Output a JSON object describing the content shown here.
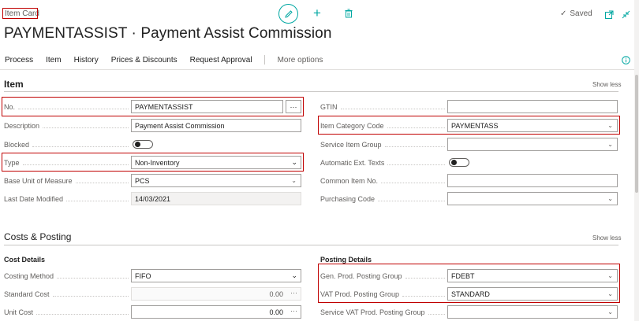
{
  "header": {
    "caption": "Item Card",
    "title": "PAYMENTASSIST · Payment Assist Commission",
    "saved_label": "Saved"
  },
  "action_bar": {
    "items": [
      "Process",
      "Item",
      "History",
      "Prices & Discounts",
      "Request Approval"
    ],
    "more_options": "More options"
  },
  "sections": {
    "item": {
      "title": "Item",
      "show_less": "Show less"
    },
    "costs": {
      "title": "Costs & Posting",
      "show_less": "Show less",
      "cost_details": "Cost Details",
      "posting_details": "Posting Details"
    }
  },
  "item_left": [
    {
      "label": "No.",
      "value": "PAYMENTASSIST"
    },
    {
      "label": "Description",
      "value": "Payment Assist Commission"
    },
    {
      "label": "Blocked",
      "value": "off"
    },
    {
      "label": "Type",
      "value": "Non-Inventory"
    },
    {
      "label": "Base Unit of Measure",
      "value": "PCS"
    },
    {
      "label": "Last Date Modified",
      "value": "14/03/2021"
    }
  ],
  "item_right": [
    {
      "label": "GTIN",
      "value": ""
    },
    {
      "label": "Item Category Code",
      "value": "PAYMENTASS"
    },
    {
      "label": "Service Item Group",
      "value": ""
    },
    {
      "label": "Automatic Ext. Texts",
      "value": "off"
    },
    {
      "label": "Common Item No.",
      "value": ""
    },
    {
      "label": "Purchasing Code",
      "value": ""
    }
  ],
  "cost_left": [
    {
      "label": "Costing Method",
      "value": "FIFO"
    },
    {
      "label": "Standard Cost",
      "value": "0.00"
    },
    {
      "label": "Unit Cost",
      "value": "0.00"
    }
  ],
  "posting_right": [
    {
      "label": "Gen. Prod. Posting Group",
      "value": "FDEBT"
    },
    {
      "label": "VAT Prod. Posting Group",
      "value": "STANDARD"
    },
    {
      "label": "Service VAT Prod. Posting Group",
      "value": ""
    }
  ],
  "colors": {
    "accent": "#00a7a2",
    "highlight": "#c00000"
  }
}
